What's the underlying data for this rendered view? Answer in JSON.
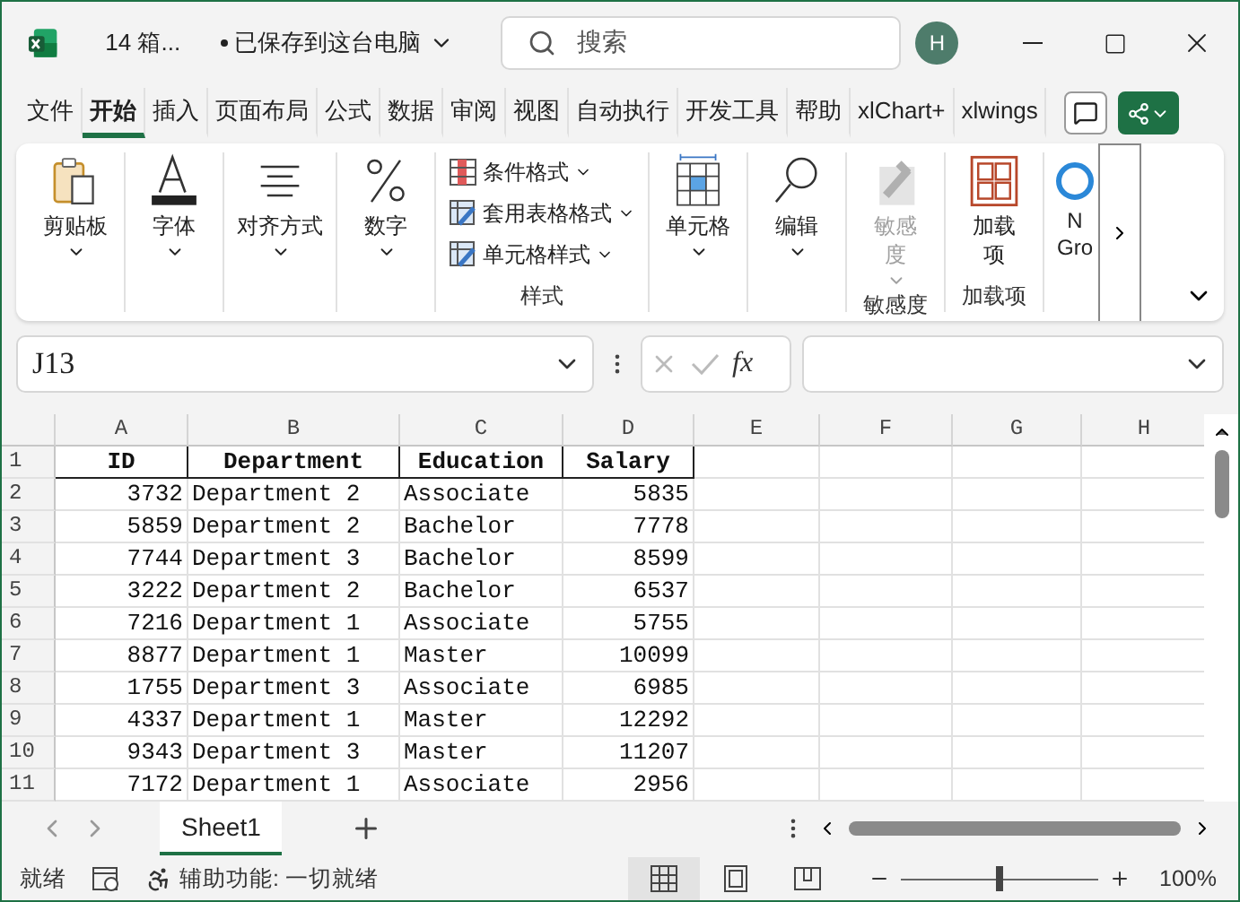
{
  "title_bar": {
    "file_name": "14 箱...",
    "save_status": "已保存到这台电脑",
    "search_placeholder": "搜索",
    "avatar": "H"
  },
  "menu_tabs": [
    {
      "label": "文件",
      "selected": false
    },
    {
      "label": "开始",
      "selected": true
    },
    {
      "label": "插入",
      "selected": false
    },
    {
      "label": "页面布局",
      "selected": false
    },
    {
      "label": "公式",
      "selected": false
    },
    {
      "label": "数据",
      "selected": false
    },
    {
      "label": "审阅",
      "selected": false
    },
    {
      "label": "视图",
      "selected": false
    },
    {
      "label": "自动执行",
      "selected": false
    },
    {
      "label": "开发工具",
      "selected": false
    },
    {
      "label": "帮助",
      "selected": false
    },
    {
      "label": "xlChart+",
      "selected": false
    },
    {
      "label": "xlwings",
      "selected": false
    }
  ],
  "ribbon": {
    "groups": [
      {
        "kind": "large",
        "items": [
          {
            "label": "剪贴板",
            "has_menu": true,
            "disabled": false
          }
        ]
      },
      {
        "kind": "large",
        "items": [
          {
            "label": "字体",
            "has_menu": true,
            "disabled": false
          }
        ]
      },
      {
        "kind": "large",
        "items": [
          {
            "label": "对齐方式",
            "has_menu": true,
            "disabled": false
          }
        ]
      },
      {
        "kind": "large",
        "items": [
          {
            "label": "数字",
            "has_menu": true,
            "disabled": false
          }
        ]
      },
      {
        "kind": "stack",
        "label": "样式",
        "items": [
          {
            "label": "条件格式"
          },
          {
            "label": "套用表格格式"
          },
          {
            "label": "单元格样式"
          }
        ]
      },
      {
        "kind": "large",
        "items": [
          {
            "label": "单元格",
            "has_menu": true,
            "disabled": false
          }
        ]
      },
      {
        "kind": "large",
        "items": [
          {
            "label": "编辑",
            "has_menu": true,
            "disabled": false
          }
        ]
      },
      {
        "kind": "large",
        "label": "敏感度",
        "items": [
          {
            "label": "敏感度",
            "has_menu": true,
            "disabled": true
          }
        ]
      },
      {
        "kind": "large",
        "label": "加载项",
        "items": [
          {
            "label": "加载项",
            "has_menu": false,
            "disabled": false
          }
        ]
      },
      {
        "kind": "cut",
        "items": [
          {
            "label": "N"
          },
          {
            "label": "Gro"
          }
        ]
      }
    ]
  },
  "formula_bar": {
    "name_box": "J13",
    "function_label": "fx"
  },
  "sheet": {
    "columns": [
      "A",
      "B",
      "C",
      "D",
      "E",
      "F",
      "G",
      "H"
    ],
    "rows": [
      {
        "number": "1",
        "kind": "header",
        "cells": [
          "ID",
          "Department",
          "Education",
          "Salary"
        ]
      },
      {
        "number": "2",
        "kind": "data",
        "cells": [
          "3732",
          "Department 2",
          "Associate",
          "5835"
        ]
      },
      {
        "number": "3",
        "kind": "data",
        "cells": [
          "5859",
          "Department 2",
          "Bachelor",
          "7778"
        ]
      },
      {
        "number": "4",
        "kind": "data",
        "cells": [
          "7744",
          "Department 3",
          "Bachelor",
          "8599"
        ]
      },
      {
        "number": "5",
        "kind": "data",
        "cells": [
          "3222",
          "Department 2",
          "Bachelor",
          "6537"
        ]
      },
      {
        "number": "6",
        "kind": "data",
        "cells": [
          "7216",
          "Department 1",
          "Associate",
          "5755"
        ]
      },
      {
        "number": "7",
        "kind": "data",
        "cells": [
          "8877",
          "Department 1",
          "Master",
          "10099"
        ]
      },
      {
        "number": "8",
        "kind": "data",
        "cells": [
          "1755",
          "Department 3",
          "Associate",
          "6985"
        ]
      },
      {
        "number": "9",
        "kind": "data",
        "cells": [
          "4337",
          "Department 1",
          "Master",
          "12292"
        ]
      },
      {
        "number": "10",
        "kind": "data",
        "cells": [
          "9343",
          "Department 3",
          "Master",
          "11207"
        ]
      },
      {
        "number": "11",
        "kind": "data",
        "cells": [
          "7172",
          "Department 1",
          "Associate",
          "2956"
        ]
      }
    ]
  },
  "sheet_tabs": [
    {
      "label": "Sheet1",
      "selected": true
    }
  ],
  "status_bar": {
    "ready": "就绪",
    "accessibility": "辅助功能: 一切就绪",
    "views": [
      {
        "selected": true
      },
      {
        "selected": false
      },
      {
        "selected": false
      }
    ],
    "zoom": "100%",
    "zoom_level": {
      "level": 0.5
    }
  }
}
